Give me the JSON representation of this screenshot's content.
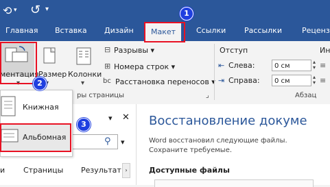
{
  "quick_access": {
    "undo_icon": "undo-icon",
    "redo_icon": "redo-icon",
    "dropdown_icon": "chevron-down-icon"
  },
  "tabs": [
    {
      "label": "Главная"
    },
    {
      "label": "Вставка"
    },
    {
      "label": "Дизайн"
    },
    {
      "label": "Макет"
    },
    {
      "label": "Ссылки"
    },
    {
      "label": "Рассылки"
    },
    {
      "label": "Рецензи"
    }
  ],
  "ribbon": {
    "orientation_label": "ментация",
    "size_label": "Размер",
    "columns_label": "Колонки",
    "breaks_label": "Разрывы",
    "line_numbers_label": "Номера строк",
    "hyphenation_label": "Расстановка переносов",
    "page_setup_group": "ры страницы",
    "indent_title": "Отступ",
    "interval_title": "Ин",
    "left_label": "Слева:",
    "left_value": "0 см",
    "right_label": "Справа:",
    "right_value": "0 см",
    "paragraph_group": "Абзац"
  },
  "orientation_menu": {
    "portrait": "Книжная",
    "landscape": "Альбомная"
  },
  "nav_pane": {
    "tab_pages": "Страницы",
    "tab_results": "Результат"
  },
  "doc_pane": {
    "title": "Восстановление докуме",
    "message_line1": "Word восстановил следующие файлы.",
    "message_line2": "Сохраните требуемые.",
    "available_files": "Доступные файлы"
  },
  "annotations": {
    "badge1": "1",
    "badge2": "2",
    "badge3": "3",
    "color": "#e81123",
    "badge_color": "#1f3fe0"
  }
}
